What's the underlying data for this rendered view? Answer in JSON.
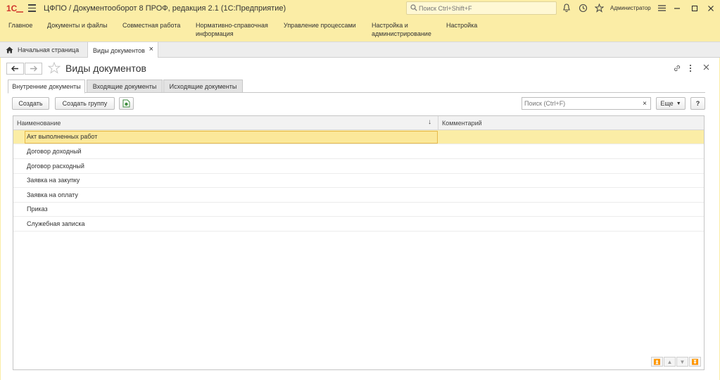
{
  "app": {
    "title": "ЦФПО / Документооборот 8 ПРОФ, редакция 2.1  (1С:Предприятие)",
    "search_placeholder": "Поиск Ctrl+Shift+F",
    "user": "Администратор",
    "accent_color": "#fbeda6"
  },
  "sections": [
    {
      "label": "Главное"
    },
    {
      "label": "Документы и файлы"
    },
    {
      "label": "Совместная работа"
    },
    {
      "label": "Нормативно-справочная информация"
    },
    {
      "label": "Управление процессами"
    },
    {
      "label": "Настройка и администрирование"
    },
    {
      "label": "Настройка"
    }
  ],
  "open_tabs": {
    "home": "Начальная страница",
    "current": "Виды документов"
  },
  "form": {
    "title": "Виды документов",
    "tabs": [
      {
        "label": "Внутренние документы",
        "active": true
      },
      {
        "label": "Входящие документы",
        "active": false
      },
      {
        "label": "Исходящие документы",
        "active": false
      }
    ],
    "commands": {
      "create": "Создать",
      "create_group": "Создать группу",
      "search_placeholder": "Поиск (Ctrl+F)",
      "more": "Еще",
      "help": "?"
    },
    "table": {
      "columns": [
        "Наименование",
        "Комментарий"
      ],
      "rows": [
        {
          "name": "Акт выполненных работ",
          "comment": "",
          "selected": true
        },
        {
          "name": "Договор доходный",
          "comment": ""
        },
        {
          "name": "Договор расходный",
          "comment": ""
        },
        {
          "name": "Заявка на закупку",
          "comment": ""
        },
        {
          "name": "Заявка на оплату",
          "comment": ""
        },
        {
          "name": "Приказ",
          "comment": ""
        },
        {
          "name": "Служебная записка",
          "comment": ""
        }
      ]
    }
  }
}
